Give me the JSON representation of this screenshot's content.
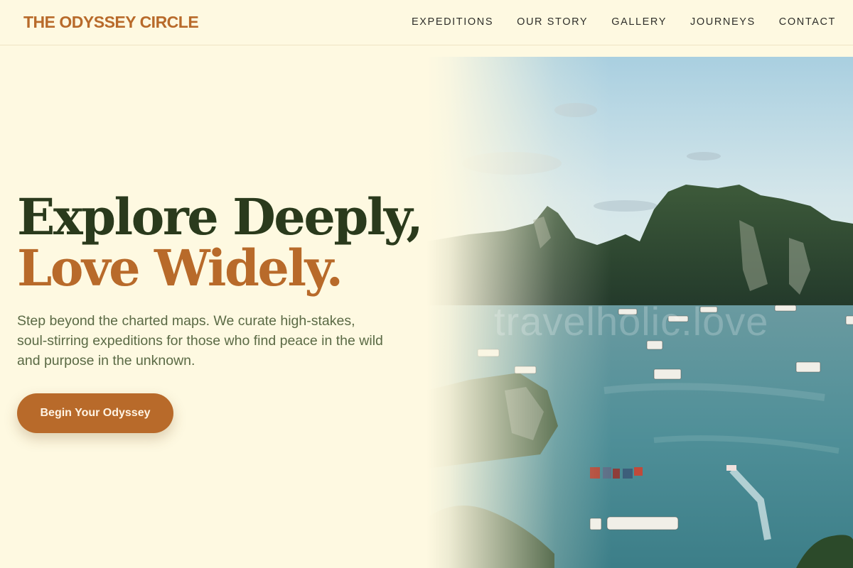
{
  "header": {
    "brand": "THE ODYSSEY CIRCLE",
    "nav": [
      {
        "label": "EXPEDITIONS"
      },
      {
        "label": "OUR STORY"
      },
      {
        "label": "GALLERY"
      },
      {
        "label": "JOURNEYS"
      },
      {
        "label": "CONTACT"
      }
    ]
  },
  "hero": {
    "title_line1": "Explore Deeply,",
    "title_line2": "Love Widely.",
    "subtitle": "Step beyond the charted maps. We curate high-stakes, soul-stirring expeditions for those who find peace in the wild and purpose in the unknown.",
    "cta_label": "Begin Your Odyssey",
    "watermark": "travelholic.love",
    "image_description_icon": "landscape-photo"
  },
  "colors": {
    "background": "#fef9e1",
    "accent": "#b86a2a",
    "heading": "#2a3a1c",
    "body_text": "#5b6a45"
  }
}
